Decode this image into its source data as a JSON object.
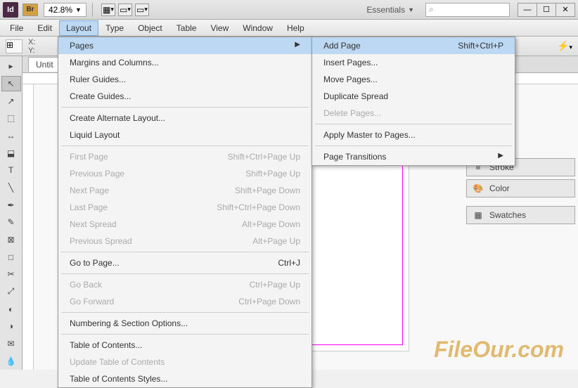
{
  "titlebar": {
    "app_logo": "Id",
    "bridge_badge": "Br",
    "zoom": "42.8%",
    "workspace": "Essentials",
    "search_placeholder": "⌕"
  },
  "menubar": [
    "File",
    "Edit",
    "Layout",
    "Type",
    "Object",
    "Table",
    "View",
    "Window",
    "Help"
  ],
  "control_panel": {
    "x_label": "X:",
    "y_label": "Y:"
  },
  "doc_tab": "Untit",
  "layout_menu": [
    {
      "label": "Pages",
      "shortcut": "",
      "submenu": true,
      "highlight": true
    },
    {
      "label": "Margins and Columns...",
      "shortcut": ""
    },
    {
      "label": "Ruler Guides...",
      "shortcut": ""
    },
    {
      "label": "Create Guides...",
      "shortcut": ""
    },
    {
      "sep": true
    },
    {
      "label": "Create Alternate Layout...",
      "shortcut": ""
    },
    {
      "label": "Liquid Layout",
      "shortcut": ""
    },
    {
      "sep": true
    },
    {
      "label": "First Page",
      "shortcut": "Shift+Ctrl+Page Up",
      "disabled": true
    },
    {
      "label": "Previous Page",
      "shortcut": "Shift+Page Up",
      "disabled": true
    },
    {
      "label": "Next Page",
      "shortcut": "Shift+Page Down",
      "disabled": true
    },
    {
      "label": "Last Page",
      "shortcut": "Shift+Ctrl+Page Down",
      "disabled": true
    },
    {
      "label": "Next Spread",
      "shortcut": "Alt+Page Down",
      "disabled": true
    },
    {
      "label": "Previous Spread",
      "shortcut": "Alt+Page Up",
      "disabled": true
    },
    {
      "sep": true
    },
    {
      "label": "Go to Page...",
      "shortcut": "Ctrl+J"
    },
    {
      "sep": true
    },
    {
      "label": "Go Back",
      "shortcut": "Ctrl+Page Up",
      "disabled": true
    },
    {
      "label": "Go Forward",
      "shortcut": "Ctrl+Page Down",
      "disabled": true
    },
    {
      "sep": true
    },
    {
      "label": "Numbering & Section Options...",
      "shortcut": ""
    },
    {
      "sep": true
    },
    {
      "label": "Table of Contents...",
      "shortcut": ""
    },
    {
      "label": "Update Table of Contents",
      "shortcut": "",
      "disabled": true
    },
    {
      "label": "Table of Contents Styles...",
      "shortcut": ""
    }
  ],
  "pages_submenu": [
    {
      "label": "Add Page",
      "shortcut": "Shift+Ctrl+P",
      "highlight": true
    },
    {
      "label": "Insert Pages...",
      "shortcut": ""
    },
    {
      "label": "Move Pages...",
      "shortcut": ""
    },
    {
      "label": "Duplicate Spread",
      "shortcut": ""
    },
    {
      "label": "Delete Pages...",
      "shortcut": "",
      "disabled": true
    },
    {
      "sep": true
    },
    {
      "label": "Apply Master to Pages...",
      "shortcut": ""
    },
    {
      "sep": true
    },
    {
      "label": "Page Transitions",
      "shortcut": "",
      "submenu": true
    }
  ],
  "panels": {
    "stroke": "Stroke",
    "color": "Color",
    "swatches": "Swatches"
  },
  "watermark": "FileOur.com"
}
